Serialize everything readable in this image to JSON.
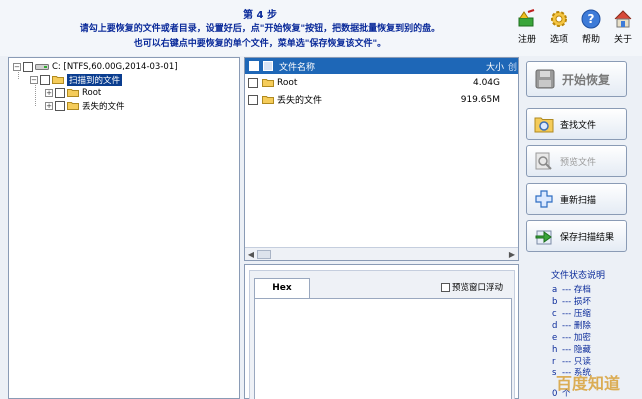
{
  "header": {
    "step": "第 4 步",
    "line1": "请勾上要恢复的文件或者目录，设置好后，点\"开始恢复\"按钮，把数据批量恢复到别的盘。",
    "line2": "也可以右键点中要恢复的单个文件，菜单选\"保存恢复该文件\"。"
  },
  "toolbar": [
    {
      "label": "注册",
      "icon": "register-icon"
    },
    {
      "label": "选项",
      "icon": "gear-icon"
    },
    {
      "label": "帮助",
      "icon": "help-icon"
    },
    {
      "label": "关于",
      "icon": "home-icon"
    }
  ],
  "tree": {
    "drive": "C: [NTFS,60.00G,2014-03-01]",
    "scanned": "扫描到的文件",
    "root": "Root",
    "lost": "丢失的文件"
  },
  "list": {
    "columns": {
      "name": "文件名称",
      "size": "大小",
      "ext": "创"
    },
    "rows": [
      {
        "name": "Root",
        "size": "4.04G"
      },
      {
        "name": "丢失的文件",
        "size": "919.65M"
      }
    ]
  },
  "hex": {
    "tab": "Hex",
    "float_label": "预览窗口浮动"
  },
  "buttons": {
    "start": "开始恢复",
    "find": "查找文件",
    "preview": "预览文件",
    "rescan": "重新扫描",
    "save": "保存扫描结果"
  },
  "legend": {
    "title": "文件状态说明",
    "items": [
      {
        "code": "a",
        "text": "--- 存档"
      },
      {
        "code": "b",
        "text": "--- 损坏"
      },
      {
        "code": "c",
        "text": "--- 压缩"
      },
      {
        "code": "d",
        "text": "--- 删除"
      },
      {
        "code": "e",
        "text": "--- 加密"
      },
      {
        "code": "h",
        "text": "--- 隐藏"
      },
      {
        "code": "r",
        "text": "--- 只读"
      },
      {
        "code": "s",
        "text": "--- 系统"
      },
      {
        "code": "0",
        "text": "个"
      }
    ]
  },
  "watermark": "百度知道",
  "colors": {
    "accent": "#1e67b7",
    "title_blue": "#0a2a9a",
    "selection": "#0a3d8f"
  }
}
